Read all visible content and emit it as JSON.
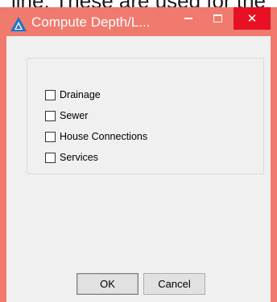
{
  "background_text": "line.  These are used for the",
  "window": {
    "title": "Compute Depth/L...",
    "controls": {
      "minimize_icon": "minimize-icon",
      "maximize_icon": "maximize-icon",
      "close_glyph": "✕"
    }
  },
  "options": [
    {
      "label": "Drainage",
      "checked": false
    },
    {
      "label": "Sewer",
      "checked": false
    },
    {
      "label": "House Connections",
      "checked": false
    },
    {
      "label": "Services",
      "checked": false
    }
  ],
  "buttons": {
    "ok_label": "OK",
    "cancel_label": "Cancel"
  },
  "colors": {
    "titlebar": "#f07a6e",
    "close_button": "#e81123",
    "client_bg": "#f0f0f0",
    "app_icon": "#1e73c8"
  }
}
